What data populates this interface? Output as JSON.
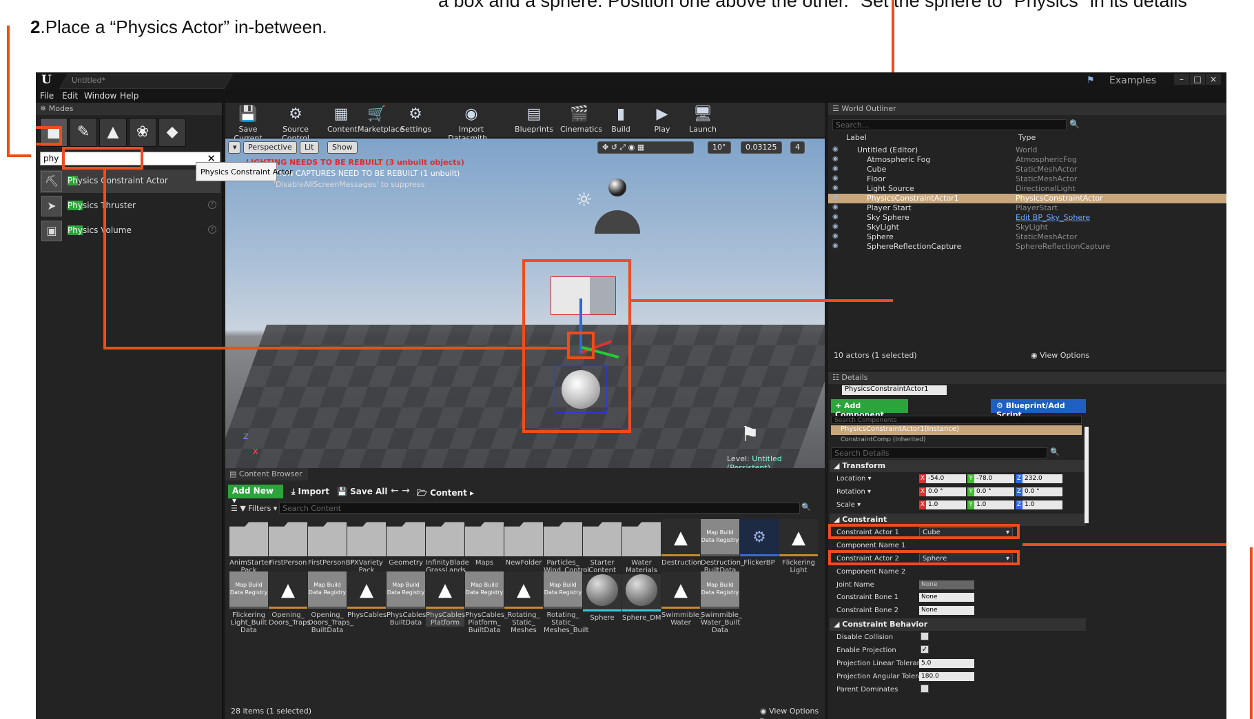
{
  "instructions": {
    "top_text": "a box and a sphere. Position one above the other.\" Set the sphere to \"Physics\" in its details",
    "step_num": "2",
    "step_text": ".Place a “Physics Actor” in-between."
  },
  "window": {
    "tab_title": "Untitled*",
    "logo": "U",
    "examples": "Examples",
    "menu": [
      "File",
      "Edit",
      "Window",
      "Help"
    ]
  },
  "modes": {
    "header": "Modes",
    "search_value": "phy",
    "items": [
      {
        "hl": "Ph",
        "rest": "ysics Constraint Actor"
      },
      {
        "hl": "Phy",
        "rest": "sics Thruster"
      },
      {
        "hl": "Phy",
        "rest": "sics Volume"
      }
    ],
    "tooltip": "Physics Constraint Actor"
  },
  "toolbar": [
    "Save Current",
    "Source Control",
    "Content",
    "Marketplace",
    "Settings",
    "Import Datasmith...",
    "Blueprints",
    "Cinematics",
    "Build",
    "Play",
    "Launch"
  ],
  "viewport": {
    "perspective": "Perspective",
    "lit": "Lit",
    "show": "Show",
    "warn1": "LIGHTING NEEDS TO BE REBUILT (3 unbuilt objects)",
    "warn2": "REFLECTION CAPTURES NEED TO BE REBUILT (1 unbuilt)",
    "warn3": "'DisableAllScreenMessages' to suppress",
    "angle": "10°",
    "scale": "0.03125",
    "cam_speed": "4",
    "level_label": "Level:",
    "level_name": "Untitled (Persistent)",
    "axis_z": "Z",
    "axis_x": "X"
  },
  "outliner": {
    "header": "World Outliner",
    "search_placeholder": "Search...",
    "col_label": "Label",
    "col_type": "Type",
    "rows": [
      {
        "label": "Untitled (Editor)",
        "type": "World"
      },
      {
        "label": "Atmospheric Fog",
        "type": "AtmosphericFog"
      },
      {
        "label": "Cube",
        "type": "StaticMeshActor"
      },
      {
        "label": "Floor",
        "type": "StaticMeshActor"
      },
      {
        "label": "Light Source",
        "type": "DirectionalLight"
      },
      {
        "label": "PhysicsConstraintActor1",
        "type": "PhysicsConstraintActor"
      },
      {
        "label": "Player Start",
        "type": "PlayerStart"
      },
      {
        "label": "Sky Sphere",
        "type": "Edit BP_Sky_Sphere"
      },
      {
        "label": "SkyLight",
        "type": "SkyLight"
      },
      {
        "label": "Sphere",
        "type": "StaticMeshActor"
      },
      {
        "label": "SphereReflectionCapture",
        "type": "SphereReflectionCapture"
      }
    ],
    "footer": "10 actors (1 selected)",
    "view_options": "View Options"
  },
  "details": {
    "header": "Details",
    "actor_name": "PhysicsConstraintActor1",
    "add_component": "+ Add Component",
    "blueprint": "Blueprint/Add Script",
    "search_components": "Search Components",
    "instance": "PhysicsConstraintActor1(Instance)",
    "inherited": "ConstraintComp (Inherited)",
    "search_details": "Search Details",
    "transform": "Transform",
    "location": "Location",
    "rotation": "Rotation",
    "scale": "Scale",
    "loc": [
      "-54.0",
      "-78.0",
      "232.0"
    ],
    "rot": [
      "0.0 °",
      "0.0 °",
      "0.0 °"
    ],
    "scl": [
      "1.0",
      "1.0",
      "1.0"
    ],
    "axes": [
      "X",
      "Y",
      "Z"
    ],
    "constraint": "Constraint",
    "actor1_label": "Constraint Actor 1",
    "actor1_value": "Cube",
    "comp1": "Component Name 1",
    "actor2_label": "Constraint Actor 2",
    "actor2_value": "Sphere",
    "comp2": "Component Name 2",
    "joint_name": "Joint Name",
    "joint_value": "None",
    "bone1": "Constraint Bone 1",
    "bone1_value": "None",
    "bone2": "Constraint Bone 2",
    "bone2_value": "None",
    "behavior": "Constraint Behavior",
    "disable_collision": "Disable Collision",
    "enable_projection": "Enable Projection",
    "proj_linear": "Projection Linear Tolerance",
    "proj_linear_value": "5.0",
    "proj_angular": "Projection Angular Tolerance",
    "proj_angular_value": "180.0",
    "parent_dominates": "Parent Dominates"
  },
  "content_browser": {
    "header": "Content Browser",
    "add_new": "Add New",
    "import": "Import",
    "save_all": "Save All",
    "path": "Content",
    "filters": "Filters",
    "search_placeholder": "Search Content",
    "footer": "28 items (1 selected)",
    "view_options": "View Options",
    "row1": [
      {
        "name": "AnimStarter Pack",
        "kind": "folder"
      },
      {
        "name": "FirstPerson",
        "kind": "folder"
      },
      {
        "name": "FirstPersonBP",
        "kind": "folder"
      },
      {
        "name": "FXVariety Pack",
        "kind": "folder"
      },
      {
        "name": "Geometry",
        "kind": "folder"
      },
      {
        "name": "InfinityBlade GrassLands",
        "kind": "folder"
      },
      {
        "name": "Maps",
        "kind": "folder"
      },
      {
        "name": "NewFolder",
        "kind": "folder"
      },
      {
        "name": "Particles_ Wind_Control System",
        "kind": "folder"
      },
      {
        "name": "Starter Content",
        "kind": "folder"
      },
      {
        "name": "Water Materials",
        "kind": "folder"
      },
      {
        "name": "Destruction",
        "kind": "tex"
      },
      {
        "name": "Destruction_ BuiltData",
        "kind": "mapbd"
      },
      {
        "name": "FlickerBP",
        "kind": "bp"
      },
      {
        "name": "Flickering Light",
        "kind": "tex"
      }
    ],
    "row2": [
      {
        "name": "Flickering Light_Built Data",
        "kind": "mapbd"
      },
      {
        "name": "Opening_ Doors_Traps",
        "kind": "tex"
      },
      {
        "name": "Opening_ Doors_Traps_ BuiltData",
        "kind": "mapbd"
      },
      {
        "name": "PhysCables",
        "kind": "tex"
      },
      {
        "name": "PhysCables_ BuiltData",
        "kind": "mapbd"
      },
      {
        "name": "PhysCables Platform",
        "kind": "tex"
      },
      {
        "name": "PhysCables_ Platform_ BuiltData",
        "kind": "mapbd"
      },
      {
        "name": "Rotating_ Static_ Meshes",
        "kind": "tex"
      },
      {
        "name": "Rotating_ Static_ Meshes_Built",
        "kind": "mapbd"
      },
      {
        "name": "Sphere",
        "kind": "sph"
      },
      {
        "name": "Sphere_DM",
        "kind": "sph"
      },
      {
        "name": "Swimmible_ Water",
        "kind": "tex"
      },
      {
        "name": "Swimmible_ Water_Built Data",
        "kind": "mapbd"
      }
    ],
    "map_bd_label": "Map Build Data Registry"
  },
  "colors": {
    "accent_orange": "#ee4d1c",
    "selection": "#c7a67b",
    "add_green": "#2da33b",
    "blueprint_blue": "#1f5fbf"
  }
}
